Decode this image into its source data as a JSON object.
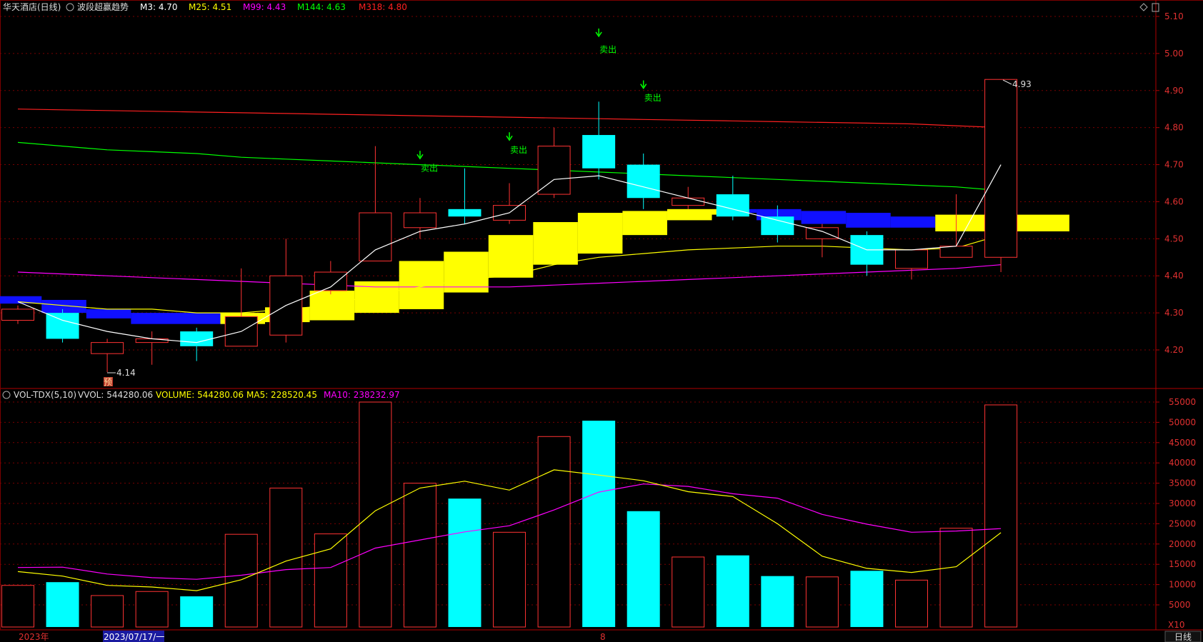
{
  "header": {
    "stock_name": "华天酒店(日线)",
    "indicator": "波段超赢趋势",
    "legend": [
      {
        "label": "M3: 4.70",
        "color": "#ffffff"
      },
      {
        "label": "M25: 4.51",
        "color": "#ffff00"
      },
      {
        "label": "M99: 4.43",
        "color": "#ff00ff"
      },
      {
        "label": "M144: 4.63",
        "color": "#00ff00"
      },
      {
        "label": "M318: 4.80",
        "color": "#ff2020"
      }
    ]
  },
  "volume_header": {
    "name": "VOL-TDX(5,10)",
    "legend": [
      {
        "label": "VVOL: 544280.06",
        "color": "#dddddd"
      },
      {
        "label": "VOLUME: 544280.06",
        "color": "#ffff00"
      },
      {
        "label": "MA5: 228520.45",
        "color": "#ffff00"
      },
      {
        "label": "MA10: 238232.97",
        "color": "#ff00ff"
      }
    ]
  },
  "bottom_bar": {
    "year": "2023年",
    "date": "2023/07/17/一",
    "month": "8",
    "period": "日线",
    "multiplier": "X10"
  },
  "annotations": {
    "low": "4.14",
    "high": "4.93",
    "pre_tag": "预",
    "sell": "卖出"
  },
  "colors": {
    "up": "#ff3333",
    "down": "#00ffff",
    "grid": "#7a0000",
    "m3": "#ffffff",
    "m25": "#ffff00",
    "m99": "#ff00ff",
    "m144": "#00ff00",
    "m318": "#ff2020"
  },
  "chart_data": [
    {
      "type": "candlestick",
      "ylim": [
        4.1,
        5.12
      ],
      "yticks": [
        "5.10",
        "5.00",
        "4.90",
        "4.80",
        "4.70",
        "4.60",
        "4.50",
        "4.40",
        "4.30",
        "4.20"
      ],
      "candles": [
        {
          "o": 4.28,
          "c": 4.31,
          "h": 4.32,
          "l": 4.27
        },
        {
          "o": 4.3,
          "c": 4.23,
          "h": 4.31,
          "l": 4.22
        },
        {
          "o": 4.19,
          "c": 4.22,
          "h": 4.23,
          "l": 4.14
        },
        {
          "o": 4.22,
          "c": 4.23,
          "h": 4.25,
          "l": 4.16
        },
        {
          "o": 4.25,
          "c": 4.21,
          "h": 4.26,
          "l": 4.17
        },
        {
          "o": 4.21,
          "c": 4.29,
          "h": 4.42,
          "l": 4.21
        },
        {
          "o": 4.24,
          "c": 4.4,
          "h": 4.5,
          "l": 4.22
        },
        {
          "o": 4.36,
          "c": 4.41,
          "h": 4.44,
          "l": 4.35
        },
        {
          "o": 4.44,
          "c": 4.57,
          "h": 4.75,
          "l": 4.44
        },
        {
          "o": 4.53,
          "c": 4.57,
          "h": 4.61,
          "l": 4.5
        },
        {
          "o": 4.58,
          "c": 4.56,
          "h": 4.69,
          "l": 4.54
        },
        {
          "o": 4.55,
          "c": 4.59,
          "h": 4.65,
          "l": 4.54
        },
        {
          "o": 4.62,
          "c": 4.75,
          "h": 4.8,
          "l": 4.61
        },
        {
          "o": 4.78,
          "c": 4.69,
          "h": 4.87,
          "l": 4.66
        },
        {
          "o": 4.7,
          "c": 4.61,
          "h": 4.73,
          "l": 4.58
        },
        {
          "o": 4.59,
          "c": 4.61,
          "h": 4.64,
          "l": 4.58
        },
        {
          "o": 4.62,
          "c": 4.56,
          "h": 4.67,
          "l": 4.55
        },
        {
          "o": 4.56,
          "c": 4.51,
          "h": 4.59,
          "l": 4.49
        },
        {
          "o": 4.5,
          "c": 4.53,
          "h": 4.54,
          "l": 4.45
        },
        {
          "o": 4.51,
          "c": 4.43,
          "h": 4.52,
          "l": 4.4
        },
        {
          "o": 4.42,
          "c": 4.47,
          "h": 4.47,
          "l": 4.39
        },
        {
          "o": 4.45,
          "c": 4.48,
          "h": 4.62,
          "l": 4.45
        },
        {
          "o": 4.45,
          "c": 4.93,
          "h": 4.93,
          "l": 4.41
        }
      ],
      "m3": [
        4.33,
        4.28,
        4.25,
        4.23,
        4.22,
        4.25,
        4.32,
        4.37,
        4.47,
        4.52,
        4.54,
        4.57,
        4.66,
        4.67,
        4.64,
        4.61,
        4.58,
        4.55,
        4.52,
        4.47,
        4.47,
        4.48,
        4.7
      ],
      "m25": [
        4.33,
        4.32,
        4.31,
        4.31,
        4.3,
        4.3,
        4.31,
        4.32,
        4.35,
        4.37,
        4.39,
        4.4,
        4.43,
        4.45,
        4.46,
        4.47,
        4.475,
        4.48,
        4.48,
        4.475,
        4.47,
        4.475,
        4.51
      ],
      "m99": [
        4.41,
        4.405,
        4.4,
        4.395,
        4.39,
        4.385,
        4.38,
        4.375,
        4.37,
        4.37,
        4.37,
        4.37,
        4.375,
        4.38,
        4.385,
        4.39,
        4.395,
        4.4,
        4.405,
        4.41,
        4.415,
        4.42,
        4.43
      ],
      "m144": [
        4.76,
        4.75,
        4.74,
        4.735,
        4.73,
        4.72,
        4.715,
        4.71,
        4.705,
        4.7,
        4.695,
        4.69,
        4.685,
        4.68,
        4.675,
        4.67,
        4.665,
        4.66,
        4.655,
        4.65,
        4.645,
        4.64,
        4.63
      ],
      "m318": [
        4.85,
        4.848,
        4.846,
        4.844,
        4.842,
        4.84,
        4.838,
        4.836,
        4.834,
        4.832,
        4.83,
        4.828,
        4.826,
        4.824,
        4.822,
        4.82,
        4.818,
        4.816,
        4.814,
        4.812,
        4.81,
        4.805,
        4.8
      ],
      "blue_band": [
        {
          "from": 0,
          "to": 1,
          "top": 4.345,
          "bottom": 4.325
        },
        {
          "from": 1,
          "to": 2,
          "top": 4.335,
          "bottom": 4.3
        },
        {
          "from": 2,
          "to": 3,
          "top": 4.31,
          "bottom": 4.285
        },
        {
          "from": 3,
          "to": 5,
          "top": 4.3,
          "bottom": 4.27
        },
        {
          "from": 5,
          "to": 5.6,
          "top": 4.285,
          "bottom": 4.27
        },
        {
          "from": 16,
          "to": 17,
          "top": 4.58,
          "bottom": 4.57
        },
        {
          "from": 17,
          "to": 18,
          "top": 4.58,
          "bottom": 4.55
        },
        {
          "from": 18,
          "to": 19,
          "top": 4.575,
          "bottom": 4.54
        },
        {
          "from": 19,
          "to": 20,
          "top": 4.57,
          "bottom": 4.53
        },
        {
          "from": 20,
          "to": 21,
          "top": 4.56,
          "bottom": 4.53
        },
        {
          "from": 21,
          "to": 22,
          "top": 4.545,
          "bottom": 4.525
        }
      ],
      "yellow_band": [
        {
          "from": 5,
          "to": 6,
          "top": 4.3,
          "bottom": 4.27
        },
        {
          "from": 6,
          "to": 7,
          "top": 4.315,
          "bottom": 4.275
        },
        {
          "from": 7,
          "to": 8,
          "top": 4.36,
          "bottom": 4.28
        },
        {
          "from": 8,
          "to": 9,
          "top": 4.385,
          "bottom": 4.3
        },
        {
          "from": 9,
          "to": 10,
          "top": 4.44,
          "bottom": 4.31
        },
        {
          "from": 10,
          "to": 11,
          "top": 4.465,
          "bottom": 4.355
        },
        {
          "from": 11,
          "to": 12,
          "top": 4.51,
          "bottom": 4.395
        },
        {
          "from": 12,
          "to": 13,
          "top": 4.545,
          "bottom": 4.43
        },
        {
          "from": 13,
          "to": 14,
          "top": 4.57,
          "bottom": 4.46
        },
        {
          "from": 14,
          "to": 15,
          "top": 4.575,
          "bottom": 4.51
        },
        {
          "from": 15,
          "to": 16,
          "top": 4.58,
          "bottom": 4.55
        },
        {
          "from": 16,
          "to": 16.5,
          "top": 4.58,
          "bottom": 4.565
        },
        {
          "from": 21,
          "to": 24,
          "top": 4.565,
          "bottom": 4.52
        }
      ],
      "sell_signals": [
        {
          "index": 9,
          "arrow": 4.72,
          "label": 4.69
        },
        {
          "index": 11,
          "arrow": 4.77,
          "label": 4.74
        },
        {
          "index": 13,
          "arrow": 5.05,
          "label": 5.01
        },
        {
          "index": 14,
          "arrow": 4.91,
          "label": 4.88
        }
      ]
    },
    {
      "type": "bar",
      "ylim": [
        0,
        57500
      ],
      "yticks": [
        "55000",
        "50000",
        "45000",
        "40000",
        "35000",
        "30000",
        "25000",
        "20000",
        "15000",
        "10000",
        "5000"
      ],
      "values": [
        9800,
        10600,
        7300,
        8300,
        7100,
        22400,
        33800,
        22500,
        55000,
        35000,
        31200,
        22900,
        46500,
        50400,
        28100,
        16800,
        17200,
        12100,
        11900,
        13400,
        11100,
        23900,
        54300
      ],
      "ma5": [
        13200,
        12100,
        9800,
        9400,
        8500,
        11200,
        15800,
        18800,
        28200,
        33800,
        35500,
        33300,
        38300,
        37000,
        35600,
        32900,
        31700,
        25000,
        17000,
        14000,
        13000,
        14400,
        22800
      ],
      "ma10": [
        14200,
        14300,
        12600,
        11700,
        11300,
        12300,
        13700,
        14200,
        19000,
        21000,
        23000,
        24500,
        28400,
        32800,
        34800,
        34200,
        32400,
        31300,
        27300,
        24900,
        22900,
        23200,
        23800
      ]
    }
  ]
}
